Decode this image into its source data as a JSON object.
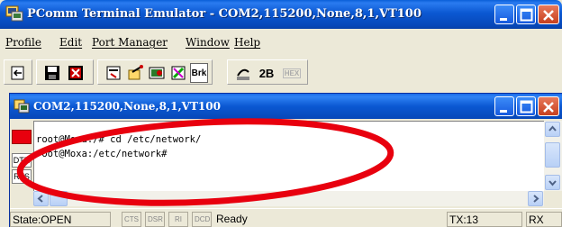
{
  "window": {
    "title": "PComm Terminal Emulator - COM2,115200,None,8,1,VT100"
  },
  "menu": [
    "Profile",
    "Edit",
    "Port Manager",
    "Window",
    "Help"
  ],
  "toolbar": {
    "break_label": "Brk",
    "two_b_label": "2B",
    "hex_label": "HEX"
  },
  "child_window": {
    "title": "COM2,115200,None,8,1,VT100"
  },
  "signals": {
    "dtr": "DTR",
    "rts": "RTS"
  },
  "terminal": {
    "lines": [
      "root@Moxa:/# cd /etc/network/",
      "root@Moxa:/etc/network#"
    ]
  },
  "status": {
    "state": "State:OPEN",
    "cts": "CTS",
    "dsr": "DSR",
    "ri": "RI",
    "dcd": "DCD",
    "ready": "Ready",
    "tx": "TX:13",
    "rx": "RX"
  },
  "colors": {
    "annotation_ring": "#e8000e",
    "titlebar": "#0b58d2"
  }
}
